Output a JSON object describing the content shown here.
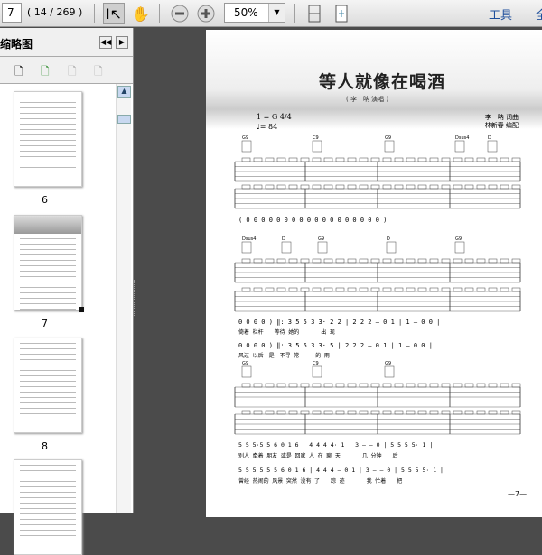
{
  "toolbar": {
    "page_number": "7",
    "page_count": "( 14 / 269 )",
    "zoom": "50%",
    "tools_label": "工具",
    "more_label": "全"
  },
  "sidebar": {
    "title": "页面缩略图",
    "thumbnails": [
      {
        "label": "6"
      },
      {
        "label": "7",
        "selected": true
      },
      {
        "label": "8"
      },
      {
        "label": ""
      }
    ]
  },
  "score": {
    "title": "等人就像在喝酒",
    "subtitle": "( 李　呐 演唱 )",
    "key": "1 = G 4/4",
    "tempo": "♩= 84",
    "credit1": "李　呐 词曲",
    "credit2": "林新春 编配",
    "page_footer": "—7—",
    "chords_1": [
      "G9",
      "C9",
      "G9",
      "Dsus4",
      "D"
    ],
    "chords_2": [
      "Dsus4",
      "D",
      "G9",
      "D",
      "G9"
    ],
    "chords_3": [
      "G9",
      "C9",
      "G9"
    ],
    "intro_numbers": "( 0  0  0  0  0  0  0  0  0  0  0  0  0  0  0  0  0  0 )",
    "sys2_line1": "0   0   0   0 ) ‖: 3 5  5 3  3·  2 2 | 2 2  2  –  0 1 | 1  –  0  0 |",
    "sys2_lyr1": "倚着 栏杆　　等待 她的　　　　出 现",
    "sys2_line2": "0   0   0   0 ) ‖: 3 5  5 3  3·  5 | 2 2  2  –  0 1 | 1  –  0  0 |",
    "sys2_lyr2": "风过 以后　是　不寻 常　　　的 雨",
    "sys3_line1": "5 5  5·5  5 6  0 1 6 | 4 4  4  4·  1 | 3  –  –  0 | 5  5 5  5·  1 |",
    "sys3_lyr1": "别人 牵着 朋友 或是 回家 人 在 聊 天　　　　几 分钟　　后",
    "sys3_line2": "5 5  5 5 5  5 6  0 1 6 | 4 4  4  –  0 1 | 3  –  –  0 | 5  5 5  5·  1 |",
    "sys3_lyr2": "曾经 热闹的 风景 突然 没有 了　　踪 迹　　　　我 忙着　　把"
  }
}
